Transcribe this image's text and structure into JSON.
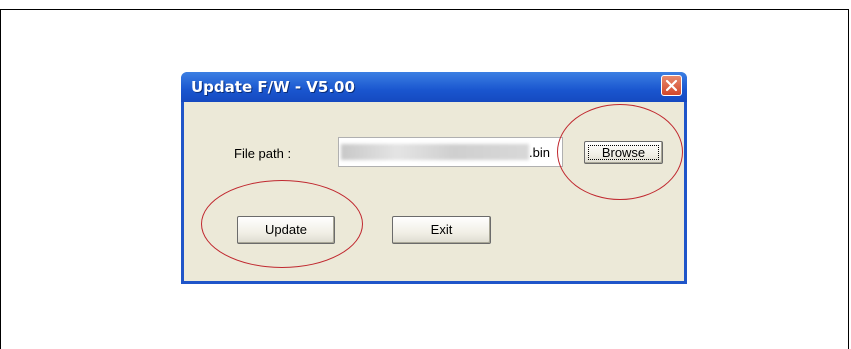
{
  "dialog": {
    "title": "Update F/W - V5.00",
    "file_path_label": "File path :",
    "file_path_value_suffix": ".bin",
    "browse_label": "Browse",
    "update_label": "Update",
    "exit_label": "Exit",
    "close_icon": "close-icon"
  },
  "colors": {
    "titlebar": "#1a56cf",
    "client": "#ece9d8",
    "highlight_ellipse": "#c0282f",
    "close_button": "#d2472a"
  }
}
